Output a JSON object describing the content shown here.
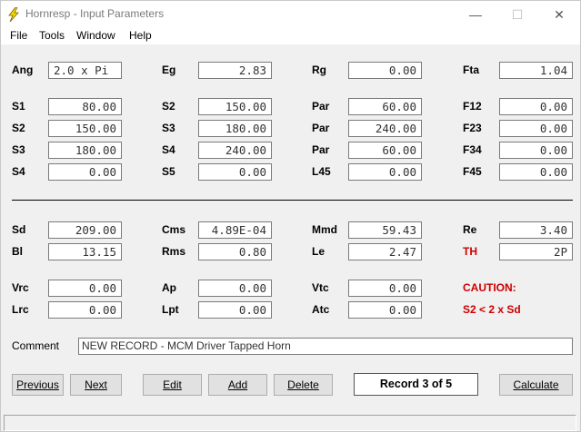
{
  "window": {
    "title": "Hornresp - Input Parameters",
    "minimize": "—",
    "maximize": "☐",
    "close": "✕"
  },
  "menu": [
    "File",
    "Tools",
    "Window",
    "Help"
  ],
  "params": {
    "Ang": "2.0 x Pi",
    "Eg": "2.83",
    "Rg": "0.00",
    "Fta": "1.04",
    "S1": "80.00",
    "S2": "150.00",
    "Par1": "60.00",
    "F12": "0.00",
    "S2b": "150.00",
    "S3": "180.00",
    "Par2": "240.00",
    "F23": "0.00",
    "S3b": "180.00",
    "S4": "240.00",
    "Par3": "60.00",
    "F34": "0.00",
    "S4b": "0.00",
    "S5": "0.00",
    "L45": "0.00",
    "F45": "0.00",
    "Sd": "209.00",
    "Cms": "4.89E-04",
    "Mmd": "59.43",
    "Re": "3.40",
    "Bl": "13.15",
    "Rms": "0.80",
    "Le": "2.47",
    "TH": "2P",
    "Vrc": "0.00",
    "Ap": "0.00",
    "Vtc": "0.00",
    "Lrc": "0.00",
    "Lpt": "0.00",
    "Atc": "0.00"
  },
  "labels": {
    "Ang": "Ang",
    "Eg": "Eg",
    "Rg": "Rg",
    "Fta": "Fta",
    "S1": "S1",
    "S2": "S2",
    "Par": "Par",
    "F12": "F12",
    "S3": "S3",
    "F23": "F23",
    "S4": "S4",
    "F34": "F34",
    "S5": "S5",
    "L45": "L45",
    "F45": "F45",
    "Sd": "Sd",
    "Cms": "Cms",
    "Mmd": "Mmd",
    "Re": "Re",
    "Bl": "Bl",
    "Rms": "Rms",
    "Le": "Le",
    "TH": "TH",
    "Vrc": "Vrc",
    "Ap": "Ap",
    "Vtc": "Vtc",
    "Lrc": "Lrc",
    "Lpt": "Lpt",
    "Atc": "Atc",
    "Comment": "Comment"
  },
  "caution": {
    "title": "CAUTION:",
    "message": "S2 < 2 x Sd"
  },
  "comment": "NEW RECORD - MCM Driver Tapped Horn",
  "buttons": {
    "previous": "Previous",
    "next": "Next",
    "edit": "Edit",
    "add": "Add",
    "delete": "Delete",
    "calculate": "Calculate"
  },
  "record": "Record 3 of 5",
  "colors": {
    "caution": "#cc0000",
    "icon": "#f5d800"
  }
}
